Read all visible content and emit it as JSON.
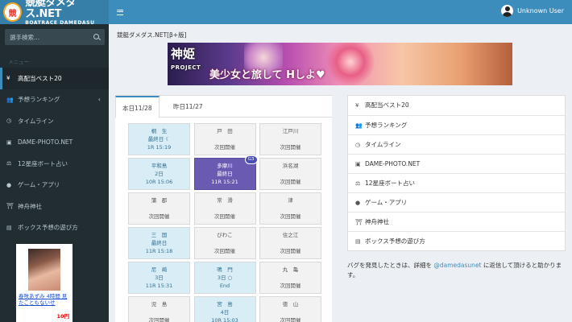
{
  "brand": {
    "logo_mark": "競",
    "title": "競艇ダメダス.NET",
    "subtitle": "BOATRACE DAMEDASU"
  },
  "header": {
    "user_name": "Unknown User"
  },
  "sidebar": {
    "search_placeholder": "選手検索...",
    "menu_header": "メニュー",
    "items": [
      {
        "label": "高配当ベスト20",
        "icon": "yen-icon",
        "glyph": "¥"
      },
      {
        "label": "予想ランキング",
        "icon": "users-icon",
        "glyph": "👥"
      },
      {
        "label": "タイムライン",
        "icon": "clock-icon",
        "glyph": "◷"
      },
      {
        "label": "DAME-PHOTO.NET",
        "icon": "camera-icon",
        "glyph": "▣"
      },
      {
        "label": "12星座ボート占い",
        "icon": "balance-scale-icon",
        "glyph": "⚖"
      },
      {
        "label": "ゲーム・アプリ",
        "icon": "gamepad-icon",
        "glyph": "●"
      },
      {
        "label": "神舟神社",
        "icon": "shrine-icon",
        "glyph": "⛩"
      },
      {
        "label": "ボックス予想の遊び方",
        "icon": "document-icon",
        "glyph": "▤"
      }
    ],
    "ad": {
      "text": "春咲あずみ 4時間 見たこともないせ",
      "price": "10円"
    }
  },
  "main": {
    "page_title": "競艇ダメダス.NET[β+版]",
    "banner": {
      "logo": "神姫",
      "sub": "PROJECT",
      "catch": "美少女と旅して Hしよ♥"
    },
    "tabs": [
      {
        "label": "本日11/28",
        "active": true
      },
      {
        "label": "昨日11/27",
        "active": false
      }
    ],
    "venues": [
      {
        "name": "桐　生",
        "l2": "最終日 ☾",
        "l3": "1R 15:19",
        "state": "live"
      },
      {
        "name": "戸　田",
        "l2": "",
        "l3": "次回開催",
        "state": "closed"
      },
      {
        "name": "江戸川",
        "l2": "",
        "l3": "次回開催",
        "state": "closed"
      },
      {
        "name": "平和島",
        "l2": "2日",
        "l3": "10R 15:06",
        "state": "live"
      },
      {
        "name": "多摩川",
        "l2": "最終日",
        "l3": "11R 15:21",
        "state": "selected",
        "badge": "G3"
      },
      {
        "name": "浜名湖",
        "l2": "",
        "l3": "次回開催",
        "state": "closed"
      },
      {
        "name": "蒲　郡",
        "l2": "",
        "l3": "次回開催",
        "state": "closed"
      },
      {
        "name": "常　滑",
        "l2": "",
        "l3": "次回開催",
        "state": "closed"
      },
      {
        "name": "津",
        "l2": "",
        "l3": "次回開催",
        "state": "closed"
      },
      {
        "name": "三　国",
        "l2": "最終日",
        "l3": "11R 15:18",
        "state": "live"
      },
      {
        "name": "びわこ",
        "l2": "",
        "l3": "次回開催",
        "state": "closed"
      },
      {
        "name": "住之江",
        "l2": "",
        "l3": "次回開催",
        "state": "closed"
      },
      {
        "name": "尼　崎",
        "l2": "3日",
        "l3": "11R 15:31",
        "state": "live"
      },
      {
        "name": "鳴　門",
        "l2": "3日 ○",
        "l3": "End",
        "state": "live"
      },
      {
        "name": "丸　亀",
        "l2": "",
        "l3": "次回開催",
        "state": "closed"
      },
      {
        "name": "児　島",
        "l2": "",
        "l3": "次回開催",
        "state": "closed"
      },
      {
        "name": "宮　島",
        "l2": "4日",
        "l3": "10R 15:03",
        "state": "live"
      },
      {
        "name": "徳　山",
        "l2": "",
        "l3": "次回開催",
        "state": "closed"
      }
    ]
  },
  "right_panel": {
    "items": [
      {
        "label": "高配当ベスト20",
        "icon": "yen-icon",
        "glyph": "¥"
      },
      {
        "label": "予想ランキング",
        "icon": "users-icon",
        "glyph": "👥"
      },
      {
        "label": "タイムライン",
        "icon": "clock-icon",
        "glyph": "◷"
      },
      {
        "label": "DAME-PHOTO.NET",
        "icon": "camera-icon",
        "glyph": "▣"
      },
      {
        "label": "12星座ボート占い",
        "icon": "balance-scale-icon",
        "glyph": "⚖"
      },
      {
        "label": "ゲーム・アプリ",
        "icon": "gamepad-icon",
        "glyph": "●"
      },
      {
        "label": "神舟神社",
        "icon": "shrine-icon",
        "glyph": "⛩"
      },
      {
        "label": "ボックス予想の遊び方",
        "icon": "document-icon",
        "glyph": "▤"
      }
    ],
    "note_before": "バグを発見したときは、詳細を ",
    "note_link": "@damedasunet",
    "note_after": " に返信して頂けると助かります。"
  },
  "colors": {
    "header": "#3c8dbc",
    "logo_bg": "#367fa9",
    "sidebar": "#222d32",
    "live_cell": "#d9edf7",
    "selected_cell": "#6a5ab2"
  }
}
